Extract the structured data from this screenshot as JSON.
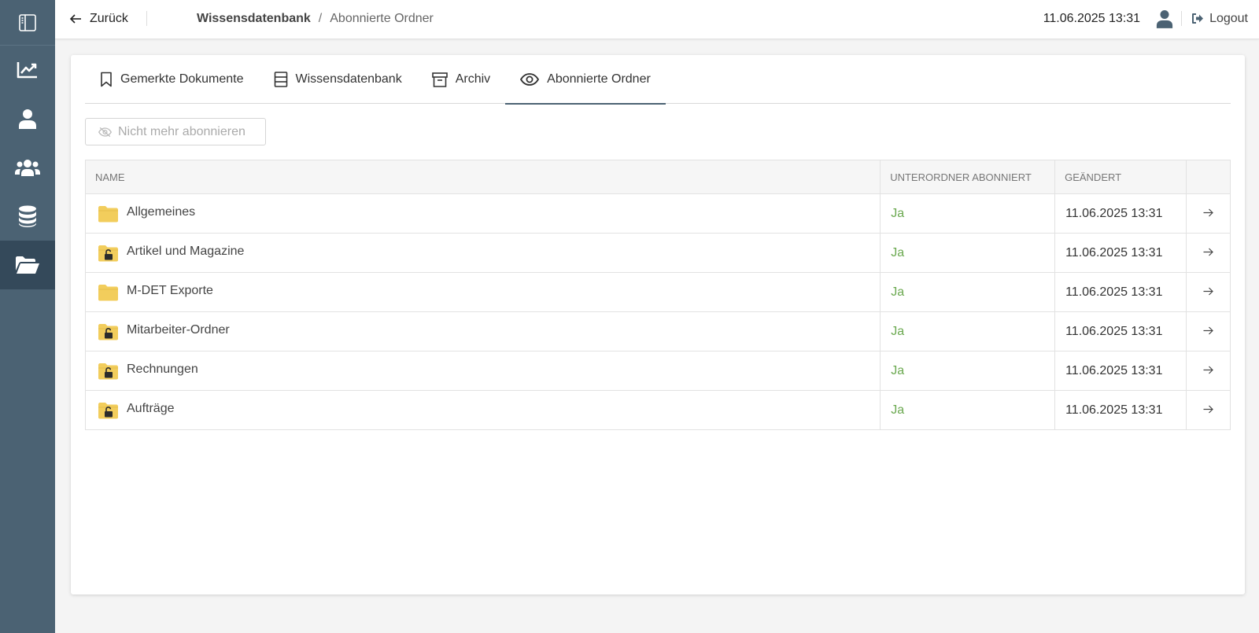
{
  "sidebar": {
    "items": [
      {
        "icon": "sidebar-toggle-icon"
      },
      {
        "icon": "chart-line-icon"
      },
      {
        "icon": "user-icon"
      },
      {
        "icon": "users-icon"
      },
      {
        "icon": "database-icon"
      },
      {
        "icon": "folder-open-icon",
        "active": true
      }
    ]
  },
  "header": {
    "back_label": "Zurück",
    "breadcrumb_root": "Wissensdatenbank",
    "breadcrumb_sep": "/",
    "breadcrumb_current": "Abonnierte Ordner",
    "datetime": "11.06.2025 13:31",
    "logout_label": "Logout"
  },
  "tabs": [
    {
      "label": "Gemerkte Dokumente",
      "icon": "bookmark-icon"
    },
    {
      "label": "Wissensdatenbank",
      "icon": "book-icon"
    },
    {
      "label": "Archiv",
      "icon": "archive-icon"
    },
    {
      "label": "Abonnierte Ordner",
      "icon": "eye-icon",
      "active": true
    }
  ],
  "unsubscribe_label": "Nicht mehr abonnieren",
  "table": {
    "headers": [
      "NAME",
      "UNTERORDNER ABONNIERT",
      "GEÄNDERT",
      ""
    ],
    "rows": [
      {
        "name": "Allgemeines",
        "locked": false,
        "sub": "Ja",
        "changed": "11.06.2025 13:31"
      },
      {
        "name": "Artikel und Magazine",
        "locked": true,
        "sub": "Ja",
        "changed": "11.06.2025 13:31"
      },
      {
        "name": "M-DET Exporte",
        "locked": false,
        "sub": "Ja",
        "changed": "11.06.2025 13:31"
      },
      {
        "name": "Mitarbeiter-Ordner",
        "locked": true,
        "sub": "Ja",
        "changed": "11.06.2025 13:31"
      },
      {
        "name": "Rechnungen",
        "locked": true,
        "sub": "Ja",
        "changed": "11.06.2025 13:31"
      },
      {
        "name": "Aufträge",
        "locked": true,
        "sub": "Ja",
        "changed": "11.06.2025 13:31"
      }
    ]
  },
  "colors": {
    "sidebar": "#4b6273",
    "sidebar_active": "#34495a",
    "folder": "#f2cd5c",
    "yes_green": "#6aa84f"
  }
}
